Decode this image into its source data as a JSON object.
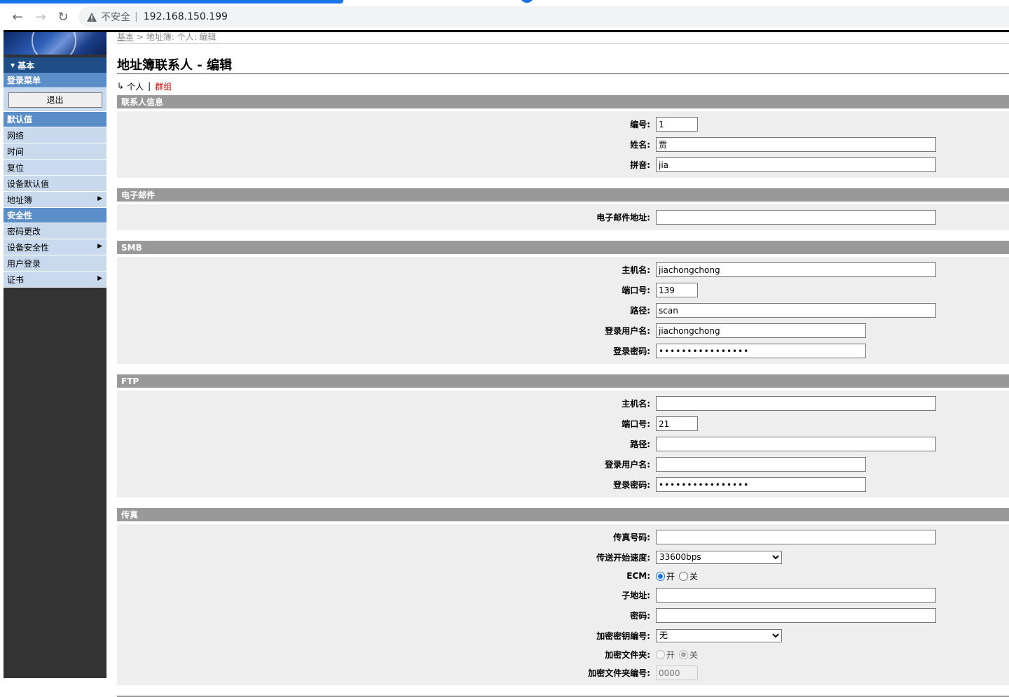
{
  "browser": {
    "insecure_label": "不安全",
    "url": "192.168.150.199"
  },
  "breadcrumb": {
    "root": "基本",
    "path": "地址簿: 个人: 编辑"
  },
  "title": "地址簿联系人 - 编辑",
  "subtabs": {
    "current": "个人",
    "other": "群组"
  },
  "sidebar": {
    "header": "基本",
    "login_section": "登录菜单",
    "logout": "退出",
    "defaults_section": "默认值",
    "defaults_items": [
      "网络",
      "时间",
      "复位",
      "设备默认值",
      "地址簿"
    ],
    "security_section": "安全性",
    "security_items": [
      "密码更改",
      "设备安全性",
      "用户登录",
      "证书"
    ]
  },
  "sections": {
    "contact": {
      "title": "联系人信息",
      "number_label": "编号:",
      "number": "1",
      "name_label": "姓名:",
      "name": "贾",
      "pinyin_label": "拼音:",
      "pinyin": "jia"
    },
    "email": {
      "title": "电子邮件",
      "address_label": "电子邮件地址:",
      "address": ""
    },
    "smb": {
      "title": "SMB",
      "host_label": "主机名:",
      "host": "jiachongchong",
      "port_label": "端口号:",
      "port": "139",
      "path_label": "路径:",
      "path": "scan",
      "user_label": "登录用户名:",
      "user": "jiachongchong",
      "pass_label": "登录密码:",
      "pass": "••••••••••••••••"
    },
    "ftp": {
      "title": "FTP",
      "host_label": "主机名:",
      "host": "",
      "port_label": "端口号:",
      "port": "21",
      "path_label": "路径:",
      "path": "",
      "user_label": "登录用户名:",
      "user": "",
      "pass_label": "登录密码:",
      "pass": "••••••••••••••••"
    },
    "fax": {
      "title": "传真",
      "number_label": "传真号码:",
      "number": "",
      "speed_label": "传送开始速度:",
      "speed": "33600bps",
      "ecm_label": "ECM:",
      "ecm_on": "开",
      "ecm_off": "关",
      "subaddr_label": "子地址:",
      "subaddr": "",
      "password_label": "密码:",
      "password": "",
      "enc_key_label": "加密密钥编号:",
      "enc_key": "无",
      "enc_folder_label": "加密文件夹:",
      "enc_folder_on": "开",
      "enc_folder_off": "关",
      "enc_folder_num_label": "加密文件夹编号:",
      "enc_folder_num": "0000"
    }
  }
}
